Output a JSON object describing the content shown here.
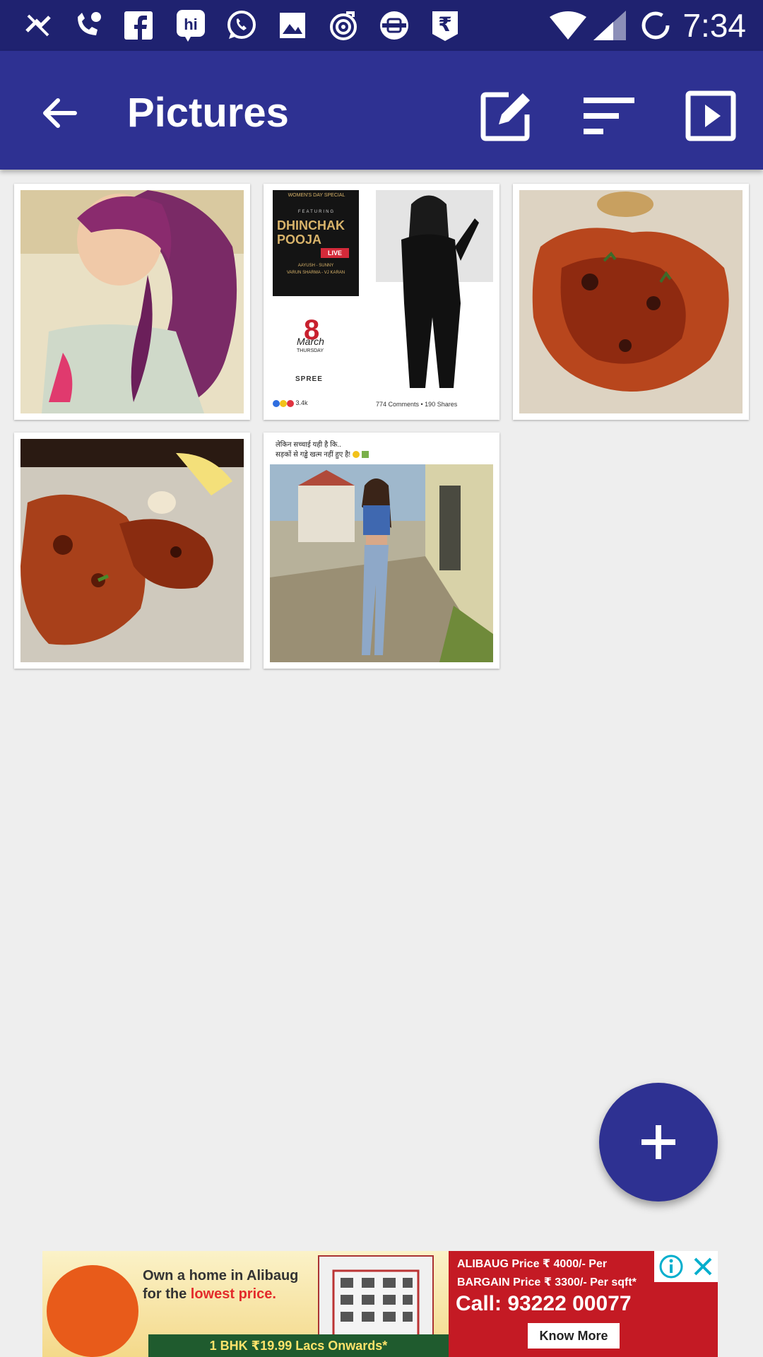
{
  "status_bar": {
    "time": "7:34",
    "icons": [
      "missed-call-icon",
      "phone-icon",
      "facebook-icon",
      "hike-icon",
      "whatsapp-icon",
      "gallery-icon",
      "music-icon",
      "transport-icon",
      "rupee-icon",
      "wifi-icon",
      "signal-icon",
      "sync-icon"
    ]
  },
  "app_bar": {
    "title": "Pictures",
    "actions": [
      "edit-icon",
      "sort-icon",
      "slideshow-icon"
    ]
  },
  "grid": {
    "items": [
      {
        "description": "selfie-photo"
      },
      {
        "description": "event-poster",
        "poster_badge": "WOMEN'S DAY SPECIAL",
        "poster_featuring": "FEATURING",
        "poster_title1": "DHINCHAK",
        "poster_title2": "POOJA",
        "poster_live": "LIVE",
        "poster_acts1": "AAYUSH - SUNNY",
        "poster_acts2": "VARUN SHARMA - VJ KARAN",
        "poster_day": "8",
        "poster_month": "March",
        "poster_weekday": "THURSDAY",
        "poster_venue": "SPREE",
        "poster_reactions": "3.4k",
        "poster_comments": "774 Comments • 190 Shares"
      },
      {
        "description": "food-photo"
      },
      {
        "description": "food-photo-2"
      },
      {
        "description": "meme-photo",
        "meme_line1": "लेकिन सच्चाई यही है कि..",
        "meme_line2": "सड़कों से गड्ढे खत्म नहीं हुए है!"
      }
    ]
  },
  "fab": {
    "icon": "add-icon"
  },
  "ad": {
    "line1": "Own a home in Alibaug",
    "line2_prefix": "for the ",
    "line2_highlight": "lowest price.",
    "bottom_strip": "1 BHK ₹19.99 Lacs Onwards*",
    "price1": "ALIBAUG Price ₹ 4000/- Per",
    "price2": "BARGAIN Price ₹ 3300/- Per sqft*",
    "call": "Call: 93222 00077",
    "cta": "Know More"
  }
}
